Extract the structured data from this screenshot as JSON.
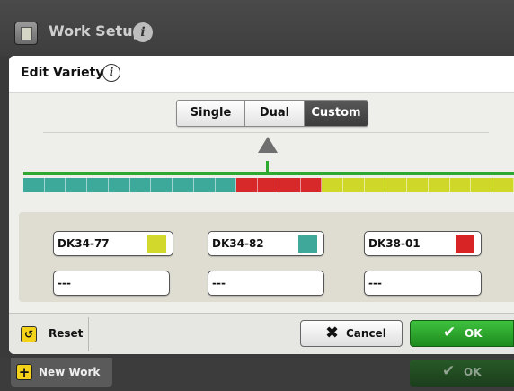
{
  "app_bar": {
    "title": "Work Setup"
  },
  "dialog": {
    "title": "Edit Variety",
    "mode_buttons": [
      {
        "label": "Single",
        "active": false
      },
      {
        "label": "Dual",
        "active": false
      },
      {
        "label": "Custom",
        "active": true
      }
    ],
    "strip_colors": {
      "teal": "#3da99a",
      "red": "#d7292a",
      "yellow": "#cfd829",
      "green_line": "#2fa82f"
    },
    "strip_sections": [
      {
        "color": "teal",
        "count": 10
      },
      {
        "color": "red",
        "count": 4
      },
      {
        "color": "yellow",
        "count": 9
      }
    ],
    "varieties": [
      {
        "name": "DK34-77",
        "color": "#d3d92c"
      },
      {
        "name": "DK34-82",
        "color": "#3fa89b"
      },
      {
        "name": "DK38-01",
        "color": "#d82424"
      }
    ],
    "empty_fields": [
      "---",
      "---",
      "---"
    ],
    "footer": {
      "reset_label": "Reset",
      "cancel_label": "Cancel",
      "ok_label": "OK"
    }
  },
  "bottom_bar": {
    "new_work_label": "New Work",
    "ok_label": "OK"
  }
}
